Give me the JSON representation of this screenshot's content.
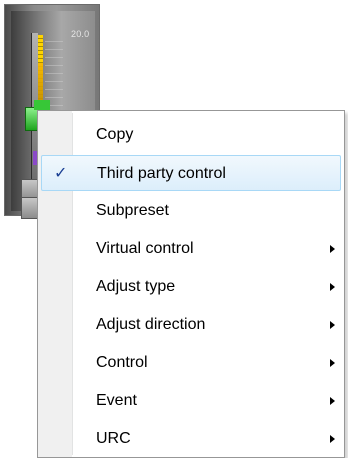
{
  "fader": {
    "meter_value": "20.0",
    "colors": {
      "knob": "#2fbf2f",
      "meter": "#ffd400",
      "marker": "#8a4ac8"
    }
  },
  "context_menu": {
    "highlight_color": "#dceefb",
    "items": [
      {
        "label": "Copy",
        "checked": false,
        "has_submenu": false
      },
      {
        "label": "Third party control",
        "checked": true,
        "has_submenu": false,
        "check_icon": "✓"
      },
      {
        "label": "Subpreset",
        "checked": false,
        "has_submenu": false
      },
      {
        "label": "Virtual control",
        "checked": false,
        "has_submenu": true,
        "submenu_icon": "chevron-right-icon"
      },
      {
        "label": "Adjust type",
        "checked": false,
        "has_submenu": true,
        "submenu_icon": "chevron-right-icon"
      },
      {
        "label": "Adjust direction",
        "checked": false,
        "has_submenu": true,
        "submenu_icon": "chevron-right-icon"
      },
      {
        "label": "Control",
        "checked": false,
        "has_submenu": true,
        "submenu_icon": "chevron-right-icon"
      },
      {
        "label": "Event",
        "checked": false,
        "has_submenu": true,
        "submenu_icon": "chevron-right-icon"
      },
      {
        "label": "URC",
        "checked": false,
        "has_submenu": true,
        "submenu_icon": "chevron-right-icon"
      }
    ]
  }
}
